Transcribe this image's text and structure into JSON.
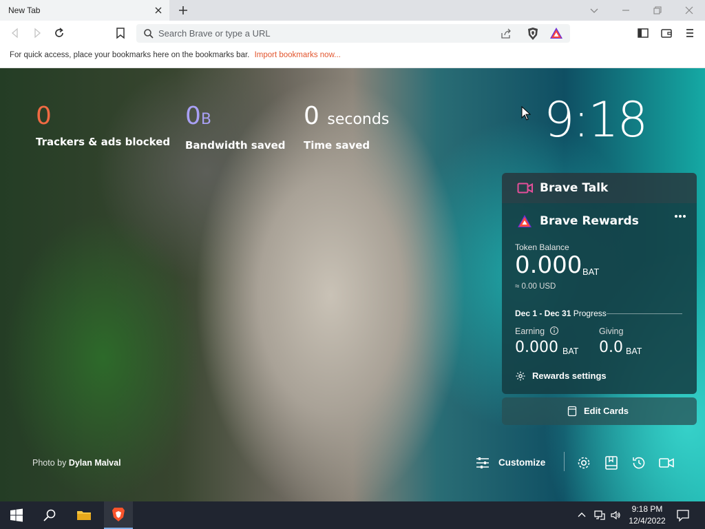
{
  "browser": {
    "tab": {
      "title": "New Tab"
    },
    "urlbar": {
      "placeholder": "Search Brave or type a URL"
    },
    "bookmarks_bar": {
      "message": "For quick access, place your bookmarks here on the bookmarks bar.",
      "import_link": "Import bookmarks now..."
    }
  },
  "ntp": {
    "stats": [
      {
        "value": "0",
        "unit": "",
        "label": "Trackers & ads blocked",
        "color": "#f06a43"
      },
      {
        "value": "0",
        "unit": "B",
        "label": "Bandwidth saved",
        "color": "#a9a0f5"
      },
      {
        "value": "0",
        "unit": "seconds",
        "label": "Time saved",
        "color": "#ffffff"
      }
    ],
    "clock": "9:18",
    "brave_talk": {
      "title": "Brave Talk"
    },
    "rewards": {
      "title": "Brave Rewards",
      "token_balance_label": "Token Balance",
      "token_balance": "0.000",
      "token_unit": "BAT",
      "usd_value": "≈ 0.00 USD",
      "period": "Dec 1 - Dec 31",
      "progress_label": "Progress",
      "earning_label": "Earning",
      "earning_value": "0.000",
      "earning_unit": "BAT",
      "giving_label": "Giving",
      "giving_value": "0.0",
      "giving_unit": "BAT",
      "settings_label": "Rewards settings"
    },
    "edit_cards": "Edit Cards",
    "photo_credit": {
      "prefix": "Photo by",
      "author": "Dylan Malval"
    },
    "customize": "Customize"
  },
  "taskbar": {
    "time": "9:18 PM",
    "date": "12/4/2022"
  },
  "colors": {
    "accent_orange": "#e2552e",
    "brave_orange": "#fb542b",
    "talk_pink": "#e64f9a"
  }
}
